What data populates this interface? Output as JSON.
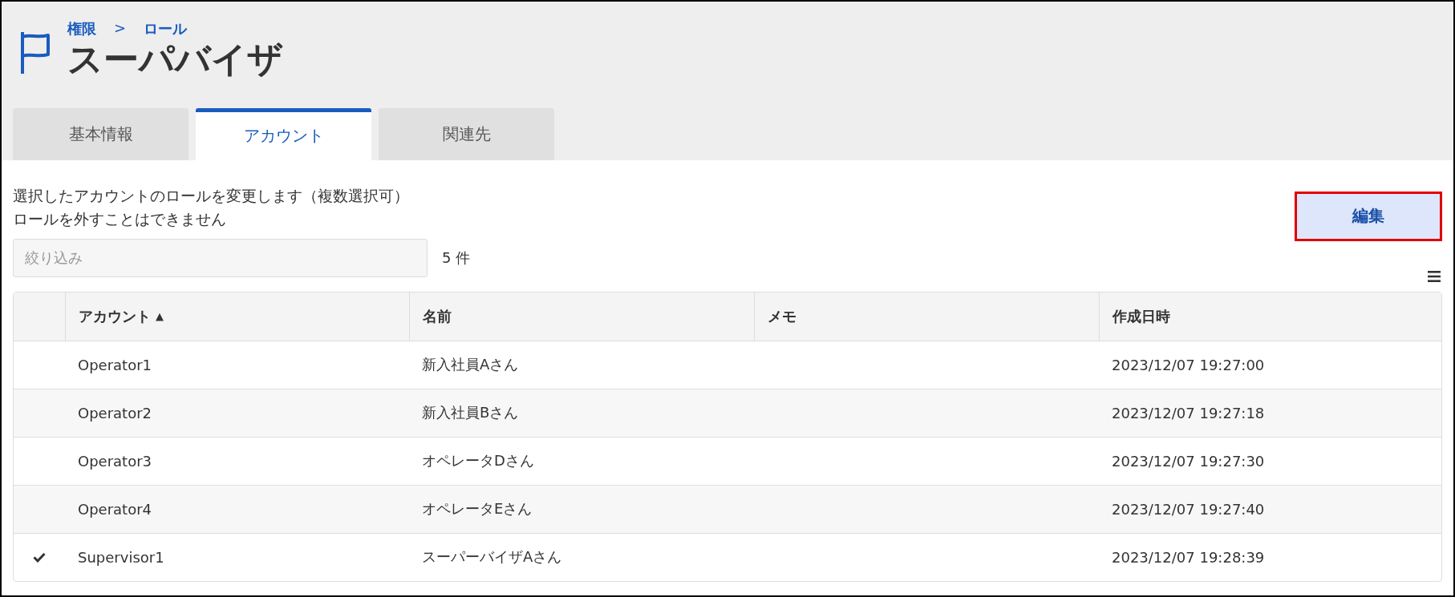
{
  "breadcrumb": [
    {
      "label": "権限"
    },
    {
      "label": "ロール"
    }
  ],
  "breadcrumb_separator": ">",
  "title": "スーパバイザ",
  "tabs": [
    {
      "label": "基本情報",
      "selected": false
    },
    {
      "label": "アカウント",
      "selected": true
    },
    {
      "label": "関連先",
      "selected": false
    }
  ],
  "description": [
    "選択したアカウントのロールを変更します（複数選択可）",
    "ロールを外すことはできません"
  ],
  "filter": {
    "placeholder": "絞り込み"
  },
  "count": "5 件",
  "edit_button": {
    "label": "編集",
    "highlighted": true
  },
  "table": {
    "columns": [
      {
        "label": "アカウント",
        "sort_indicator": "▲"
      },
      {
        "label": "名前"
      },
      {
        "label": "メモ"
      },
      {
        "label": "作成日時"
      }
    ],
    "rows": [
      {
        "selected": false,
        "cells": [
          "Operator1",
          "新入社員Aさん",
          "",
          "2023/12/07 19:27:00"
        ]
      },
      {
        "selected": false,
        "cells": [
          "Operator2",
          "新入社員Bさん",
          "",
          "2023/12/07 19:27:18"
        ]
      },
      {
        "selected": false,
        "cells": [
          "Operator3",
          "オペレータDさん",
          "",
          "2023/12/07 19:27:30"
        ]
      },
      {
        "selected": false,
        "cells": [
          "Operator4",
          "オペレータEさん",
          "",
          "2023/12/07 19:27:40"
        ]
      },
      {
        "selected": true,
        "cells": [
          "Supervisor1",
          "スーパーバイザAさん",
          "",
          "2023/12/07 19:28:39"
        ]
      }
    ]
  }
}
